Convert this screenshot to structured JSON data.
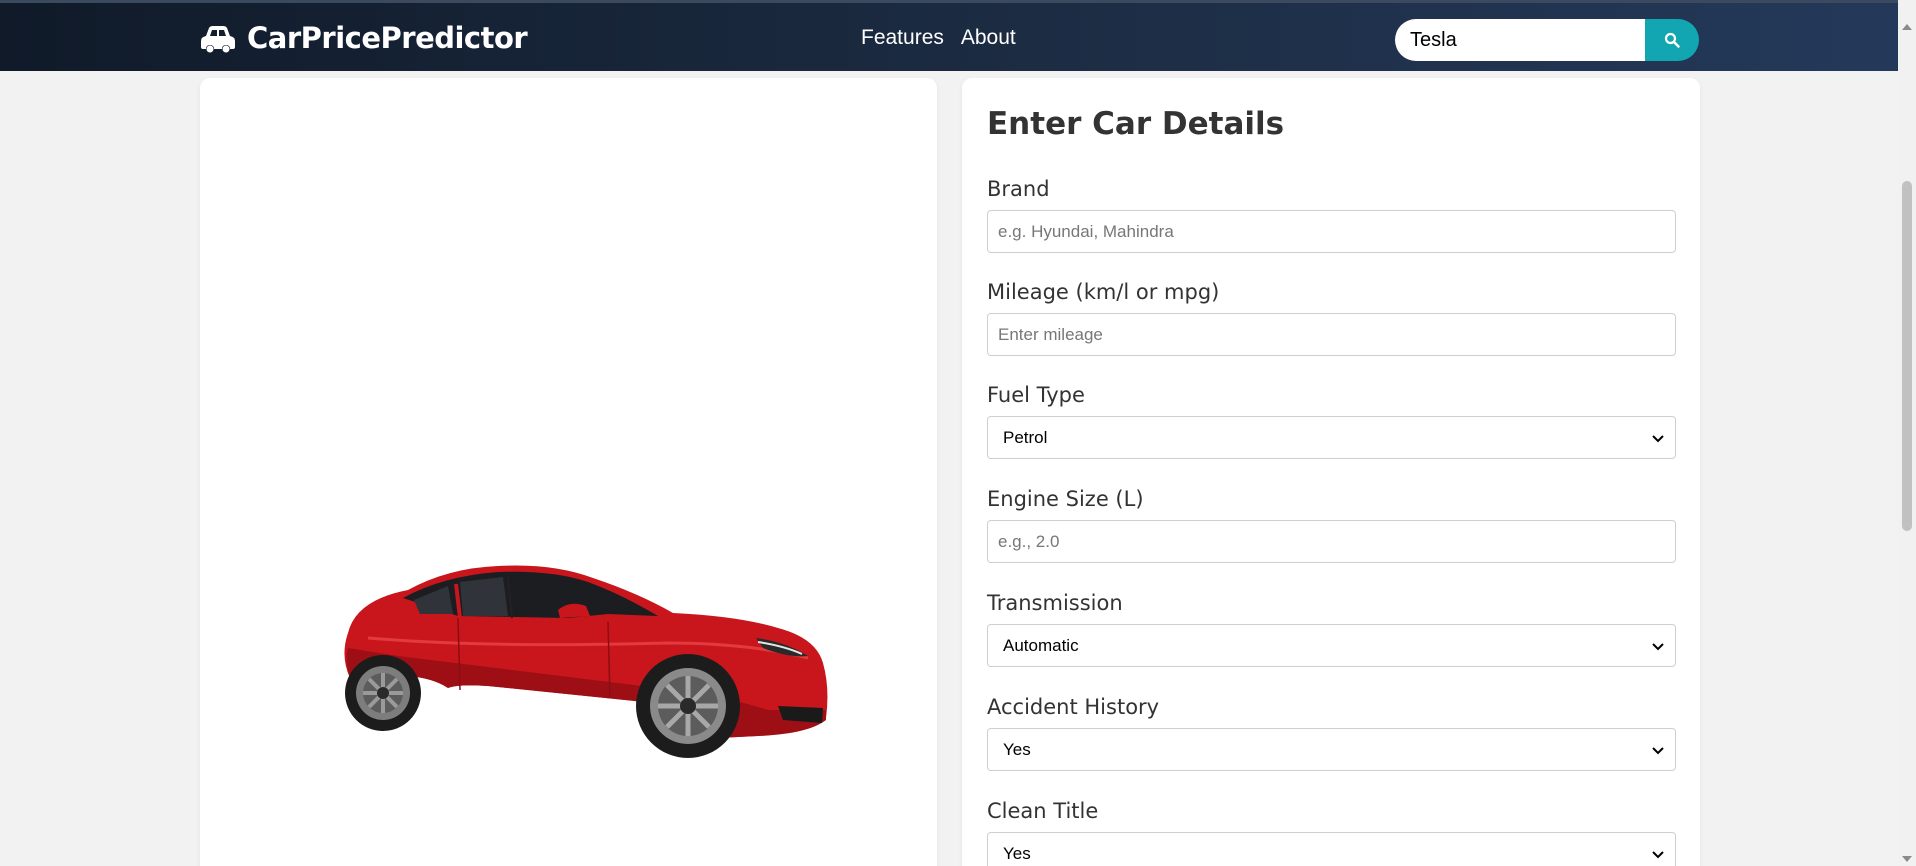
{
  "header": {
    "brand_name": "CarPricePredictor",
    "nav": [
      "Features",
      "About"
    ],
    "search": {
      "value": "Tesla"
    },
    "accent_color": "#12a6b2"
  },
  "form": {
    "title": "Enter Car Details",
    "fields": [
      {
        "label": "Brand",
        "type": "input",
        "placeholder": "e.g. Hyundai, Mahindra",
        "value": ""
      },
      {
        "label": "Mileage (km/l or mpg)",
        "type": "input",
        "placeholder": "Enter mileage",
        "value": ""
      },
      {
        "label": "Fuel Type",
        "type": "select",
        "value": "Petrol"
      },
      {
        "label": "Engine Size (L)",
        "type": "input",
        "placeholder": "e.g., 2.0",
        "value": ""
      },
      {
        "label": "Transmission",
        "type": "select",
        "value": "Automatic"
      },
      {
        "label": "Accident History",
        "type": "select",
        "value": "Yes"
      },
      {
        "label": "Clean Title",
        "type": "select",
        "value": "Yes"
      }
    ]
  },
  "preview": {
    "car_color": "#c8161c"
  }
}
